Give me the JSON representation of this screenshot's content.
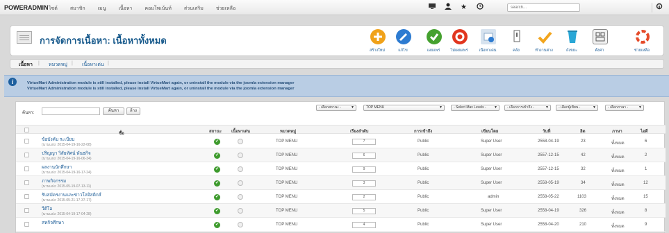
{
  "topbar": {
    "brand": "POWERADMIN",
    "menu": [
      "ไซต์",
      "สมาชิก",
      "เมนู",
      "เนื้อหา",
      "คอมโพเน้นท์",
      "ส่วนเสริม",
      "ช่วยเหลือ"
    ],
    "icons": [
      "monitor-icon",
      "user-icon",
      "star-icon",
      "clock-icon"
    ],
    "search_placeholder": "search...",
    "right_icon": "joomla-icon"
  },
  "header": {
    "title": "การจัดการเนื้อหา: เนื้อหาทั้งหมด"
  },
  "toolbar": [
    {
      "icon": "add-icon",
      "label": "สร้างใหม่",
      "color": "#f0a21a"
    },
    {
      "icon": "edit-icon",
      "label": "แก้ไข",
      "color": "#2d7bd1"
    },
    {
      "icon": "publish-icon",
      "label": "เผยแพร่",
      "color": "#45a12f"
    },
    {
      "icon": "unpublish-icon",
      "label": "ไม่เผยแพร่",
      "color": "#e1361f"
    },
    {
      "icon": "featured-icon",
      "label": "เนื้อหาเด่น",
      "color": "#8aa8c8"
    },
    {
      "icon": "archive-icon",
      "label": "คลัง",
      "color": "#666666"
    },
    {
      "icon": "checkin-icon",
      "label": "ทำงานต่าง",
      "color": "#f2a51d"
    },
    {
      "icon": "trash-icon",
      "label": "ถังขยะ",
      "color": "#29a7d6"
    },
    {
      "icon": "options-icon",
      "label": "ตั้งค่า",
      "color": "#888888"
    },
    {
      "icon": "help-icon",
      "label": "ช่วยเหลือ",
      "color": "#e54b2a"
    }
  ],
  "tabs": [
    "เนื้อหา",
    "หมวดหมู่",
    "เนื้อหาเด่น"
  ],
  "notice": {
    "lines": [
      "VirtueMart Administration module is still installed, please install VirtueMart again, or uninstall the module via the joomla extension manager",
      "VirtueMart Administration module is still installed, please install VirtueMart again, or uninstall the module via the joomla extension manager"
    ]
  },
  "filters": {
    "label": "ค้นหา:",
    "search_button": "ค้นหา",
    "clear_button": "ล้าง",
    "dropdowns": [
      "- เลือกสถานะ -",
      "TOP MENU",
      "- Select Max Levels -",
      "- เลือกการเข้าถึง -",
      "- เลือกผู้เขียน -",
      "- เลือกภาษา -"
    ]
  },
  "table": {
    "columns": [
      "ชื่อ",
      "สถานะ",
      "เนื้อหาเด่น",
      "หมวดหมู่",
      "เรียงลำดับ",
      "การเข้าถึง",
      "เขียนโดย",
      "วันที่",
      "ฮิต",
      "ภาษา",
      "ไอดี"
    ],
    "rows": [
      {
        "title": "ข้อบังคับ ระเบียบ",
        "alias": "(นามแฝง: 2015-04-19-16-22-08)",
        "category": "TOP MENU",
        "order": "7",
        "access": "Public",
        "author": "Super User",
        "date": "2558-04-19",
        "hits": "23",
        "language": "ทั้งหมด",
        "id": "6"
      },
      {
        "title": "ปริญญา วิสัยทัศน์ พันธกิจ",
        "alias": "(นามแฝง: 2015-04-19-16-06-34)",
        "category": "TOP MENU",
        "order": "6",
        "access": "Public",
        "author": "Super User",
        "date": "2557-12-15",
        "hits": "42",
        "language": "ทั้งหมด",
        "id": "2"
      },
      {
        "title": "ผลงานนักศึกษา",
        "alias": "(นามแฝง: 2015-04-19-16-17-24)",
        "category": "TOP MENU",
        "order": "9",
        "access": "Public",
        "author": "Super User",
        "date": "2557-12-15",
        "hits": "32",
        "language": "ทั้งหมด",
        "id": "1"
      },
      {
        "title": "ภาพกิจกรรม",
        "alias": "(นามแฝง: 2015-05-19-07-13-11)",
        "category": "TOP MENU",
        "order": "3",
        "access": "Public",
        "author": "Super User",
        "date": "2558-05-19",
        "hits": "34",
        "language": "ทั้งหมด",
        "id": "12"
      },
      {
        "title": "รับสมัครงานและข่าวโลจิสติกส์",
        "alias": "(นามแฝง: 2015-05-21-17-37-17)",
        "category": "TOP MENU",
        "order": "2",
        "access": "Public",
        "author": "admin",
        "date": "2558-05-22",
        "hits": "1103",
        "language": "ทั้งหมด",
        "id": "15"
      },
      {
        "title": "วีดีโอ",
        "alias": "(นามแฝง: 2015-04-19-17-04-28)",
        "category": "TOP MENU",
        "order": "5",
        "access": "Public",
        "author": "Super User",
        "date": "2558-04-19",
        "hits": "326",
        "language": "ทั้งหมด",
        "id": "8"
      },
      {
        "title": "สหกิจศึกษา",
        "alias": "",
        "category": "TOP MENU",
        "order": "4",
        "access": "Public",
        "author": "Super User",
        "date": "2558-04-20",
        "hits": "210",
        "language": "ทั้งหมด",
        "id": "9"
      }
    ]
  }
}
